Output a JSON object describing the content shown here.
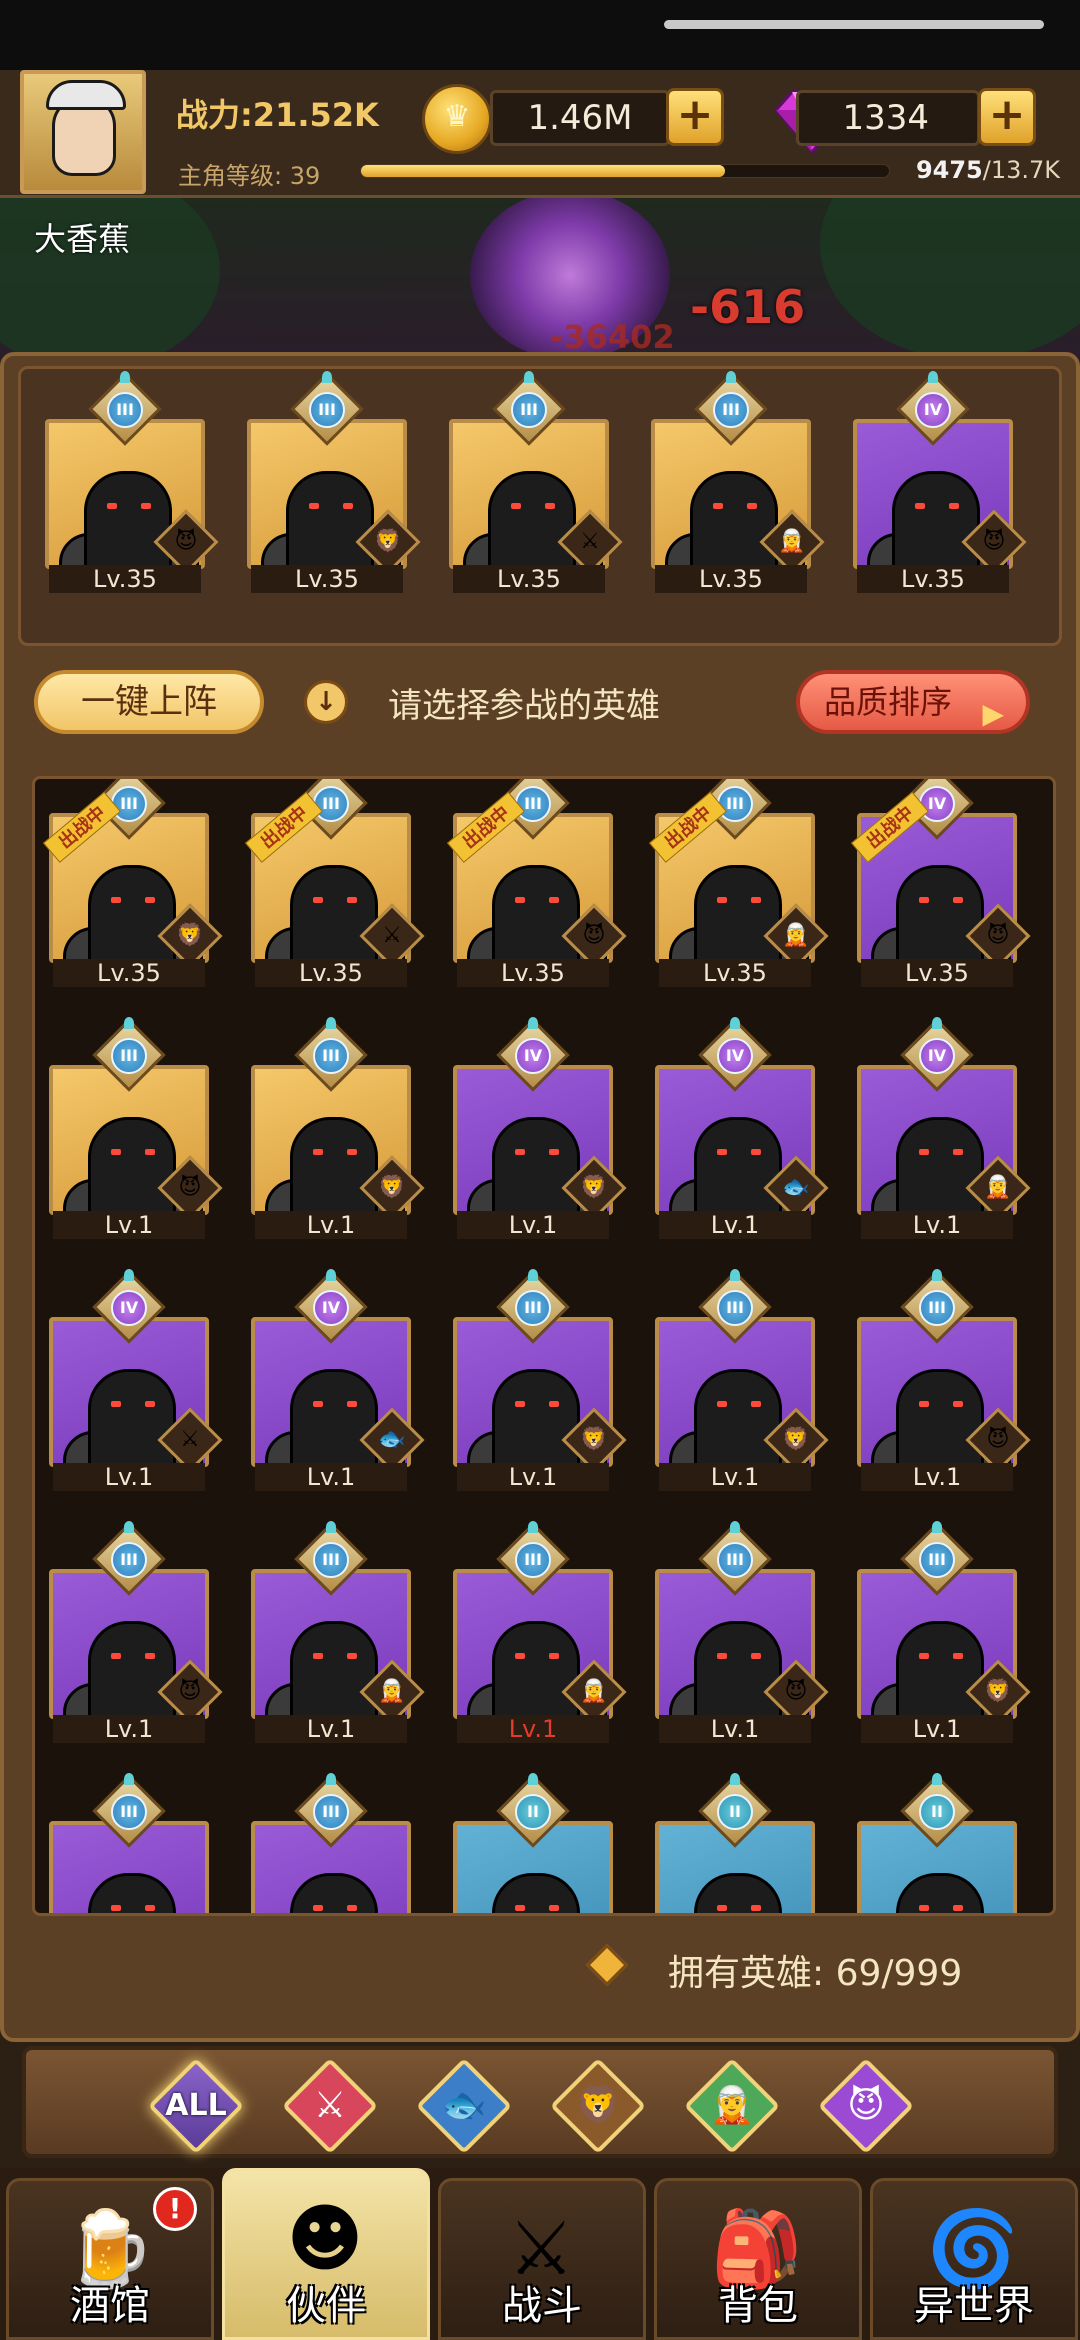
{
  "header": {
    "power": "战力:21.52K",
    "coins": "1.46M",
    "gems": "1334",
    "level_label": "主角等级:",
    "level": "39",
    "xp_current": "9475",
    "xp_total": "/13.7K",
    "xp_progress": 0.69,
    "player_name": "大香蕉"
  },
  "battle": {
    "damage_main": "-616",
    "damage_secondary": "-36402"
  },
  "team": [
    {
      "rank": "III",
      "level": "Lv.35",
      "bg": "gold",
      "faction": "demon-icon"
    },
    {
      "rank": "III",
      "level": "Lv.35",
      "bg": "gold",
      "faction": "lion-icon"
    },
    {
      "rank": "III",
      "level": "Lv.35",
      "bg": "gold",
      "faction": "knight-icon"
    },
    {
      "rank": "III",
      "level": "Lv.35",
      "bg": "gold",
      "faction": "elf-icon"
    },
    {
      "rank": "IV",
      "level": "Lv.35",
      "bg": "purple",
      "faction": "demon-icon"
    }
  ],
  "controls": {
    "auto_deploy": "一键上阵",
    "hint": "请选择参战的英雄",
    "sort": "品质排序"
  },
  "deployed_tag": "出战中",
  "roster": [
    {
      "rank": "III",
      "level": "Lv.35",
      "bg": "gold",
      "faction": "lion-icon",
      "deployed": true
    },
    {
      "rank": "III",
      "level": "Lv.35",
      "bg": "gold",
      "faction": "knight-icon",
      "deployed": true
    },
    {
      "rank": "III",
      "level": "Lv.35",
      "bg": "gold",
      "faction": "demon-icon",
      "deployed": true
    },
    {
      "rank": "III",
      "level": "Lv.35",
      "bg": "gold",
      "faction": "elf-icon",
      "deployed": true
    },
    {
      "rank": "IV",
      "level": "Lv.35",
      "bg": "purple",
      "faction": "demon-icon",
      "deployed": true
    },
    {
      "rank": "III",
      "level": "Lv.1",
      "bg": "gold",
      "faction": "demon-icon"
    },
    {
      "rank": "III",
      "level": "Lv.1",
      "bg": "gold",
      "faction": "lion-icon"
    },
    {
      "rank": "IV",
      "level": "Lv.1",
      "bg": "purple",
      "faction": "lion-icon"
    },
    {
      "rank": "IV",
      "level": "Lv.1",
      "bg": "purple",
      "faction": "fish-icon"
    },
    {
      "rank": "IV",
      "level": "Lv.1",
      "bg": "purple",
      "faction": "elf-icon"
    },
    {
      "rank": "IV",
      "level": "Lv.1",
      "bg": "purple",
      "faction": "knight-icon"
    },
    {
      "rank": "IV",
      "level": "Lv.1",
      "bg": "purple",
      "faction": "fish-icon"
    },
    {
      "rank": "III",
      "level": "Lv.1",
      "bg": "purple",
      "faction": "lion-icon"
    },
    {
      "rank": "III",
      "level": "Lv.1",
      "bg": "purple",
      "faction": "lion-icon"
    },
    {
      "rank": "III",
      "level": "Lv.1",
      "bg": "purple",
      "faction": "demon-icon"
    },
    {
      "rank": "III",
      "level": "Lv.1",
      "bg": "purple",
      "faction": "demon-icon"
    },
    {
      "rank": "III",
      "level": "Lv.1",
      "bg": "purple",
      "faction": "elf-icon"
    },
    {
      "rank": "III",
      "level": "Lv.1",
      "bg": "purple",
      "faction": "elf-icon",
      "red_level": true
    },
    {
      "rank": "III",
      "level": "Lv.1",
      "bg": "purple",
      "faction": "demon-icon"
    },
    {
      "rank": "III",
      "level": "Lv.1",
      "bg": "purple",
      "faction": "lion-icon"
    },
    {
      "rank": "III",
      "level": "",
      "bg": "purple",
      "faction": ""
    },
    {
      "rank": "III",
      "level": "",
      "bg": "purple",
      "faction": ""
    },
    {
      "rank": "II",
      "level": "",
      "bg": "blue",
      "faction": ""
    },
    {
      "rank": "II",
      "level": "",
      "bg": "blue",
      "faction": ""
    },
    {
      "rank": "II",
      "level": "",
      "bg": "blue",
      "faction": ""
    }
  ],
  "hero_count": "拥有英雄:  69/999",
  "filters": [
    {
      "label": "ALL",
      "icon": ""
    },
    {
      "label": "",
      "icon": "knight-icon"
    },
    {
      "label": "",
      "icon": "fish-icon"
    },
    {
      "label": "",
      "icon": "lion-icon"
    },
    {
      "label": "",
      "icon": "elf-icon"
    },
    {
      "label": "",
      "icon": "demon-icon"
    }
  ],
  "nav": [
    {
      "label": "酒馆",
      "icon": "beer-mug-icon",
      "badge": "!"
    },
    {
      "label": "伙伴",
      "icon": "partner-icon",
      "active": true
    },
    {
      "label": "战斗",
      "icon": "crossed-swords-icon"
    },
    {
      "label": "背包",
      "icon": "backpack-icon"
    },
    {
      "label": "异世界",
      "icon": "portal-icon"
    }
  ]
}
